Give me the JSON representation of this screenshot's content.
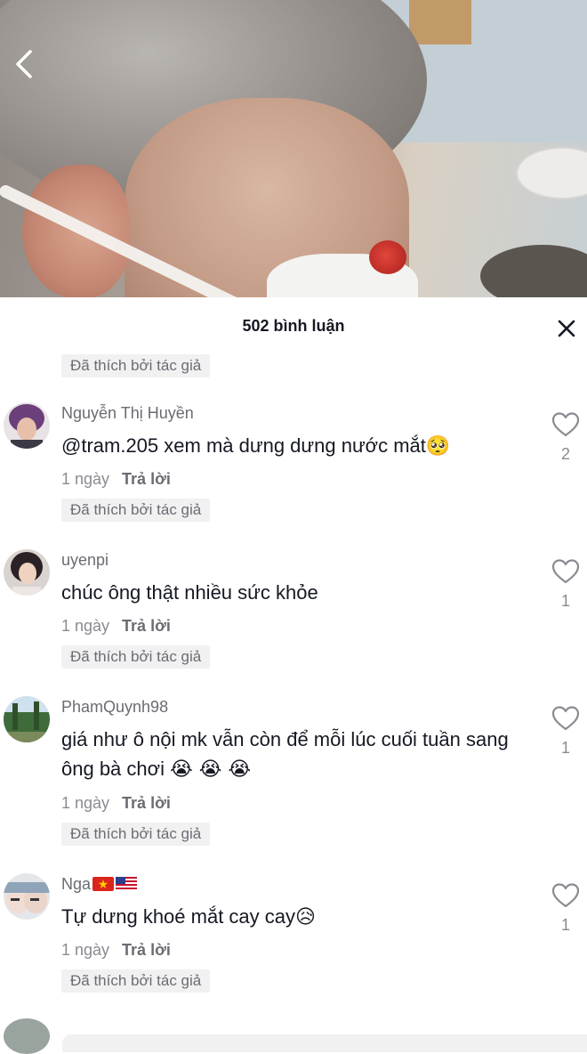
{
  "comments_panel": {
    "count_title": "502 bình luận",
    "liked_by_creator": "Đã thích bởi tác giả"
  },
  "comments": [
    {
      "username": "Nguyễn Thị Huyền",
      "mention": "@tram.205",
      "text": " xem mà dưng dưng nước mắt",
      "emoji": "🥺",
      "time": "1 ngày",
      "reply_label": "Trả lời",
      "likes": "2",
      "liked_by_creator": "Đã thích bởi tác giả"
    },
    {
      "username": "uyenpi",
      "text": "chúc ông thật nhiều sức khỏe",
      "time": "1 ngày",
      "reply_label": "Trả lời",
      "likes": "1",
      "liked_by_creator": "Đã thích bởi tác giả"
    },
    {
      "username": "PhamQuynh98",
      "text": "giá như ô nội mk vẫn còn để mỗi lúc cuối tuần sang ông bà chơi",
      "emoji": "😭 😭 😭",
      "time": "1 ngày",
      "reply_label": "Trả lời",
      "likes": "1",
      "liked_by_creator": "Đã thích bởi tác giả"
    },
    {
      "username": "Nga",
      "flags": [
        "vietnam-flag",
        "usa-flag"
      ],
      "text": "Tự dưng khoé mắt cay cay",
      "emoji": "😥",
      "time": "1 ngày",
      "reply_label": "Trả lời",
      "likes": "1",
      "liked_by_creator": "Đã thích bởi tác giả"
    }
  ],
  "icons": {
    "back": "chevron-left-icon",
    "close": "close-icon",
    "like": "heart-outline-icon"
  }
}
